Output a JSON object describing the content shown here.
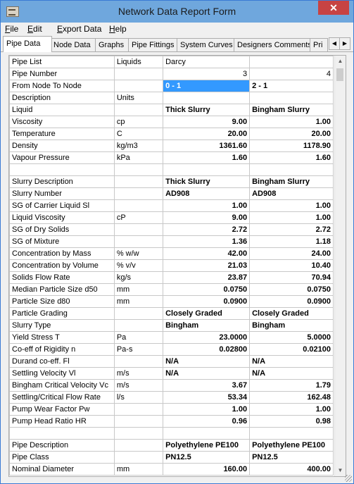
{
  "window": {
    "title": "Network Data Report Form",
    "close_glyph": "✕"
  },
  "menu": [
    {
      "first": "F",
      "rest": "ile"
    },
    {
      "first": "E",
      "rest": "dit"
    },
    {
      "first": "E",
      "rest": "xport Data"
    },
    {
      "first": "H",
      "rest": "elp"
    }
  ],
  "tabs": [
    "Pipe Data",
    "Node Data",
    "Graphs",
    "Pipe Fittings",
    "System Curves",
    "Designers Comments",
    "Pri"
  ],
  "tab_scroll": {
    "left": "◀",
    "right": "▶"
  },
  "scroll": {
    "up": "▲",
    "down": "▼"
  },
  "rows": [
    {
      "label": "Pipe List",
      "unit": "Liquids",
      "a": "Darcy",
      "b": "",
      "style": "plain"
    },
    {
      "label": "Pipe Number",
      "unit": "",
      "a": "3",
      "b": "4",
      "style": "rightplain"
    },
    {
      "label": "From Node To Node",
      "unit": "",
      "a": "0 - 1",
      "b": "2 - 1",
      "style": "selected"
    },
    {
      "label": "Description",
      "unit": "Units",
      "a": "",
      "b": "",
      "style": "plain"
    },
    {
      "label": "Liquid",
      "unit": "",
      "a": "Thick Slurry",
      "b": "Bingham Slurry",
      "style": "bold"
    },
    {
      "label": "Viscosity",
      "unit": "cp",
      "a": "9.00",
      "b": "1.00",
      "style": "num"
    },
    {
      "label": "Temperature",
      "unit": "C",
      "a": "20.00",
      "b": "20.00",
      "style": "num"
    },
    {
      "label": "Density",
      "unit": "kg/m3",
      "a": "1361.60",
      "b": "1178.90",
      "style": "num"
    },
    {
      "label": "Vapour Pressure",
      "unit": "kPa",
      "a": "1.60",
      "b": "1.60",
      "style": "num"
    },
    {
      "label": "",
      "unit": "",
      "a": "",
      "b": "",
      "style": "plain"
    },
    {
      "label": "Slurry Description",
      "unit": "",
      "a": "Thick Slurry",
      "b": "Bingham Slurry",
      "style": "bold"
    },
    {
      "label": "Slurry Number",
      "unit": "",
      "a": "AD908",
      "b": "AD908",
      "style": "bold"
    },
    {
      "label": "SG of Carrier Liquid Sl",
      "unit": "",
      "a": "1.00",
      "b": "1.00",
      "style": "num"
    },
    {
      "label": "Liquid Viscosity",
      "unit": "cP",
      "a": "9.00",
      "b": "1.00",
      "style": "num"
    },
    {
      "label": "SG of Dry Solids",
      "unit": "",
      "a": "2.72",
      "b": "2.72",
      "style": "num"
    },
    {
      "label": "SG of Mixture",
      "unit": "",
      "a": "1.36",
      "b": "1.18",
      "style": "num"
    },
    {
      "label": "Concentration by Mass",
      "unit": "% w/w",
      "a": "42.00",
      "b": "24.00",
      "style": "num"
    },
    {
      "label": "Concentration by Volume",
      "unit": "% v/v",
      "a": "21.03",
      "b": "10.40",
      "style": "num"
    },
    {
      "label": "Solids Flow Rate",
      "unit": "kg/s",
      "a": "23.87",
      "b": "70.94",
      "style": "num"
    },
    {
      "label": "Median Particle Size d50",
      "unit": "mm",
      "a": "0.0750",
      "b": "0.0750",
      "style": "num"
    },
    {
      "label": "Particle Size d80",
      "unit": "mm",
      "a": "0.0900",
      "b": "0.0900",
      "style": "num"
    },
    {
      "label": "Particle Grading",
      "unit": "",
      "a": "Closely Graded",
      "b": "Closely Graded",
      "style": "bold"
    },
    {
      "label": "Slurry Type",
      "unit": "",
      "a": "Bingham",
      "b": "Bingham",
      "style": "bold"
    },
    {
      "label": "Yield Stress T",
      "unit": "Pa",
      "a": "23.0000",
      "b": "5.0000",
      "style": "num"
    },
    {
      "label": "Co-eff of Rigidity n",
      "unit": "Pa-s",
      "a": "0.02800",
      "b": "0.02100",
      "style": "num"
    },
    {
      "label": "Durand co-eff. Fl",
      "unit": "",
      "a": "N/A",
      "b": "N/A",
      "style": "bold"
    },
    {
      "label": "Settling Velocity Vl",
      "unit": "m/s",
      "a": "N/A",
      "b": "N/A",
      "style": "bold"
    },
    {
      "label": "Bingham Critical Velocity Vc",
      "unit": "m/s",
      "a": "3.67",
      "b": "1.79",
      "style": "num"
    },
    {
      "label": "Settling/Critical Flow Rate",
      "unit": "l/s",
      "a": "53.34",
      "b": "162.48",
      "style": "num"
    },
    {
      "label": "Pump Wear Factor Pw",
      "unit": "",
      "a": "1.00",
      "b": "1.00",
      "style": "num"
    },
    {
      "label": "Pump Head Ratio HR",
      "unit": "",
      "a": "0.96",
      "b": "0.98",
      "style": "num"
    },
    {
      "label": "",
      "unit": "",
      "a": "",
      "b": "",
      "style": "plain"
    },
    {
      "label": "Pipe Description",
      "unit": "",
      "a": "Polyethylene PE100",
      "b": "Polyethylene PE100",
      "style": "bold"
    },
    {
      "label": "Pipe Class",
      "unit": "",
      "a": "PN12.5",
      "b": "PN12.5",
      "style": "bold"
    },
    {
      "label": "Nominal Diameter",
      "unit": "mm",
      "a": "160.00",
      "b": "400.00",
      "style": "num"
    }
  ]
}
